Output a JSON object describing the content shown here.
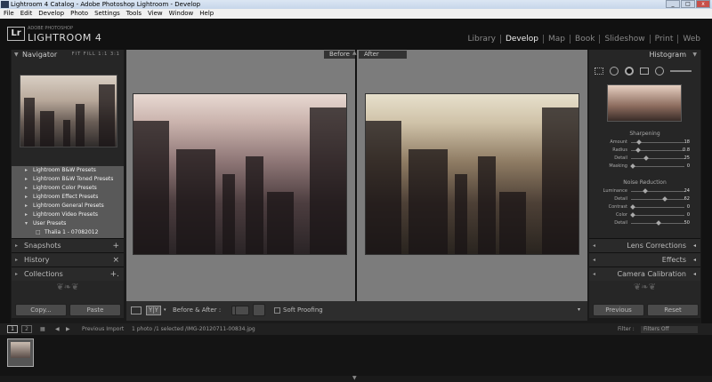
{
  "window": {
    "title": "Lightroom 4 Catalog - Adobe Photoshop Lightroom - Develop"
  },
  "menu": [
    "File",
    "Edit",
    "Develop",
    "Photo",
    "Settings",
    "Tools",
    "View",
    "Window",
    "Help"
  ],
  "brand": {
    "logo": "Lr",
    "line1": "ADOBE PHOTOSHOP",
    "line2": "LIGHTROOM 4"
  },
  "modules": [
    "Library",
    "Develop",
    "Map",
    "Book",
    "Slideshow",
    "Print",
    "Web"
  ],
  "left": {
    "navigator": {
      "title": "Navigator",
      "zoom": "FIT  FILL  1:1  3:1"
    },
    "presets": [
      "Lightroom B&W Presets",
      "Lightroom B&W Toned Presets",
      "Lightroom Color Presets",
      "Lightroom Effect Presets",
      "Lightroom General Presets",
      "Lightroom Video Presets",
      "User Presets"
    ],
    "user_preset_item": "Thalia 1 - 07082012",
    "sections": [
      {
        "label": "Snapshots",
        "action": "+"
      },
      {
        "label": "History",
        "action": "×"
      },
      {
        "label": "Collections",
        "action": "+."
      }
    ],
    "copy": "Copy...",
    "paste": "Paste"
  },
  "view": {
    "before": "Before",
    "after": "After"
  },
  "toolbar": {
    "mode": "Y|Y",
    "before_after": "Before & After :",
    "soft_proofing": "Soft Proofing"
  },
  "right": {
    "histogram": "Histogram",
    "sharpening": {
      "title": "Sharpening",
      "rows": [
        {
          "label": "Amount",
          "value": "18",
          "pos": 0.12
        },
        {
          "label": "Radius",
          "value": "0.8",
          "pos": 0.1
        },
        {
          "label": "Detail",
          "value": "25",
          "pos": 0.25
        },
        {
          "label": "Masking",
          "value": "0",
          "pos": 0.0
        }
      ]
    },
    "noise": {
      "title": "Noise Reduction",
      "rows": [
        {
          "label": "Luminance",
          "value": "24",
          "pos": 0.24
        },
        {
          "label": "Detail",
          "value": "62",
          "pos": 0.62
        },
        {
          "label": "Contrast",
          "value": "0",
          "pos": 0.0
        },
        {
          "label": "Color",
          "value": "0",
          "pos": 0.0
        },
        {
          "label": "Detail",
          "value": "50",
          "pos": 0.5
        }
      ]
    },
    "sections": [
      "Lens Corrections",
      "Effects",
      "Camera Calibration"
    ],
    "previous": "Previous",
    "reset": "Reset"
  },
  "filmstrip": {
    "pages": [
      "1",
      "2"
    ],
    "source": "Previous Import",
    "selection": "1 photo /1 selected /IMG-20120711-00834.jpg",
    "filter_label": "Filter :",
    "filter_value": "Filters Off"
  }
}
